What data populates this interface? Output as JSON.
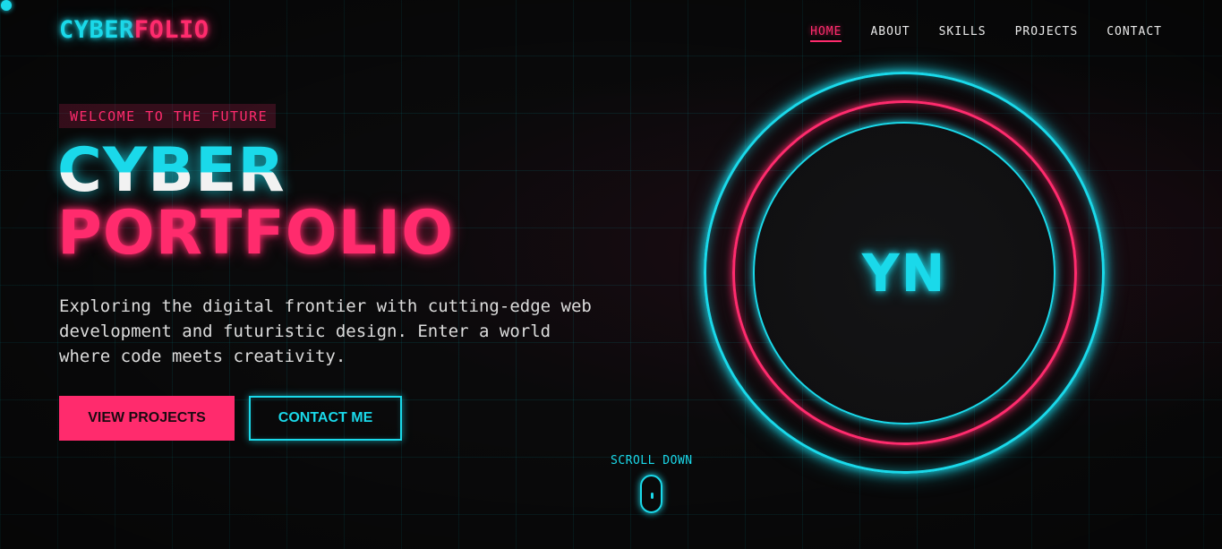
{
  "brand": {
    "part1": "CYBER",
    "part2": "FOLIO"
  },
  "nav": {
    "items": [
      {
        "label": "HOME",
        "active": true
      },
      {
        "label": "ABOUT",
        "active": false
      },
      {
        "label": "SKILLS",
        "active": false
      },
      {
        "label": "PROJECTS",
        "active": false
      },
      {
        "label": "CONTACT",
        "active": false
      }
    ]
  },
  "hero": {
    "badge": "WELCOME TO THE FUTURE",
    "title_line1": "CYBER",
    "title_line2": "PORTFOLIO",
    "description": "Exploring the digital frontier with cutting-edge web development and futuristic design. Enter a world where code meets creativity.",
    "primary_button": "VIEW PROJECTS",
    "secondary_button": "CONTACT ME"
  },
  "avatar": {
    "initials": "YN"
  },
  "scroll": {
    "label": "SCROLL DOWN"
  },
  "colors": {
    "accent_cyan": "#1ad9ea",
    "accent_pink": "#ff2b6d",
    "background": "#0a0a0b"
  }
}
